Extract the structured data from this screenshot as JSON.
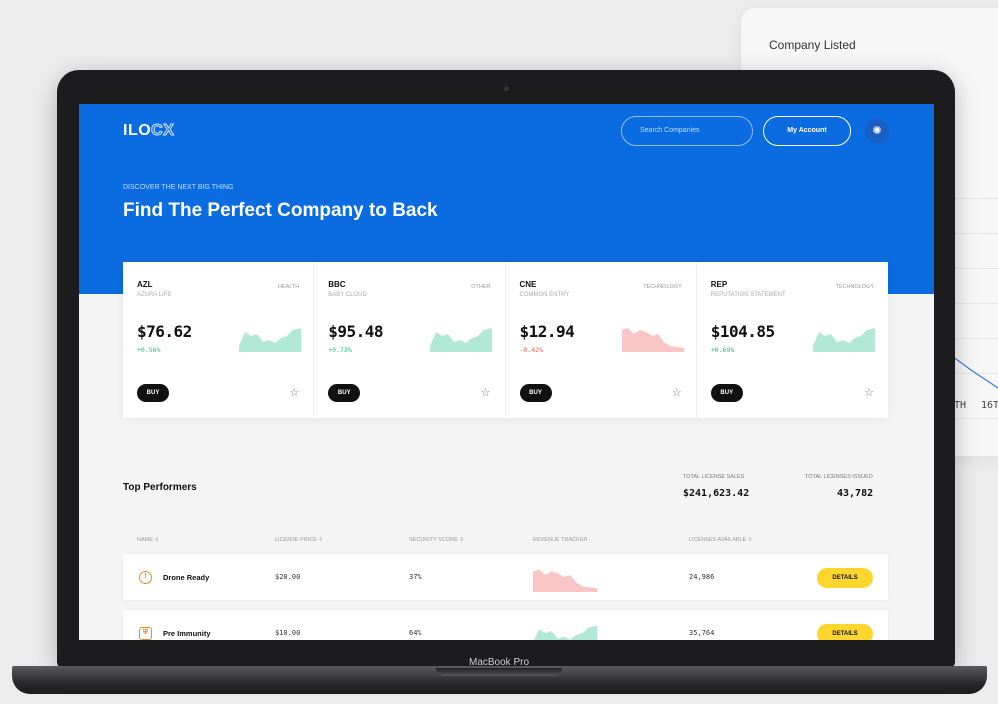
{
  "background_card": {
    "title": "Company Listed",
    "axis_ticks": [
      "TH",
      "16T"
    ]
  },
  "device": {
    "label": "MacBook Pro"
  },
  "header": {
    "logo_primary": "ILO",
    "logo_secondary": "CX",
    "search_placeholder": "Search Companies",
    "account_label": "My Account",
    "theme_icon": "sun-icon"
  },
  "hero": {
    "eyebrow": "DISCOVER THE NEXT BIG THING",
    "headline": "Find The Perfect Company to Back"
  },
  "companies": [
    {
      "symbol": "AZL",
      "name": "AZURA LIFE",
      "sector": "HEALTH",
      "price": "$76.62",
      "change": "+0.56%",
      "trend": "up",
      "buy_label": "BUY"
    },
    {
      "symbol": "BBC",
      "name": "BABY CLOUD",
      "sector": "OTHER",
      "price": "$95.48",
      "change": "+0.73%",
      "trend": "up",
      "buy_label": "BUY"
    },
    {
      "symbol": "CNE",
      "name": "COMMON ENTRY",
      "sector": "TECHNOLOGY",
      "price": "$12.94",
      "change": "-0.42%",
      "trend": "down",
      "buy_label": "BUY"
    },
    {
      "symbol": "REP",
      "name": "REPUTATION STATEMENT",
      "sector": "TECHNOLOGY",
      "price": "$104.85",
      "change": "+0.69%",
      "trend": "up",
      "buy_label": "BUY"
    }
  ],
  "top_performers": {
    "title": "Top Performers",
    "total_sales_label": "TOTAL LICENSE SALES",
    "total_sales_value": "$241,623.42",
    "total_issued_label": "TOTAL LICENSES ISSUED",
    "total_issued_value": "43,782",
    "columns": [
      "NAME ⇳",
      "LICENSE PRICE ⇳",
      "SECURITY SCORE ⇳",
      "REVENUE TRACKER",
      "LICENSES AVAILABLE ⇳"
    ],
    "rows": [
      {
        "icon": "drone-icon",
        "name": "Drone Ready",
        "price": "$20.00",
        "score": "37%",
        "trend": "down",
        "available": "24,986",
        "action": "DETAILS"
      },
      {
        "icon": "shield-icon",
        "name": "Pre Immunity",
        "price": "$10.00",
        "score": "64%",
        "trend": "up",
        "available": "35,764",
        "action": "DETAILS"
      }
    ]
  },
  "colors": {
    "brand_blue": "#0a6ce0",
    "positive": "#22c08a",
    "negative": "#f05a5a",
    "details_yellow": "#ffd62e"
  }
}
